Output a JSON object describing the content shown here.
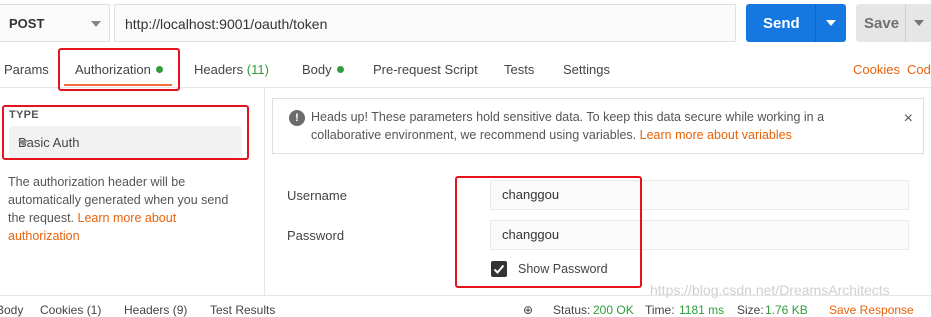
{
  "request": {
    "method": "POST",
    "url": "http://localhost:9001/oauth/token",
    "send_label": "Send",
    "save_label": "Save"
  },
  "tabs": [
    {
      "label": "Params"
    },
    {
      "label": "Authorization",
      "active": true,
      "dot": true
    },
    {
      "label": "Headers",
      "count": "(11)"
    },
    {
      "label": "Body",
      "dot": true
    },
    {
      "label": "Pre-request Script"
    },
    {
      "label": "Tests"
    },
    {
      "label": "Settings"
    }
  ],
  "tab_links": {
    "cookies": "Cookies",
    "code": "Code"
  },
  "auth": {
    "type_label": "TYPE",
    "type_value": "Basic Auth",
    "help_text": "The authorization header will be automatically generated when you send the request.",
    "help_link": "Learn more about authorization"
  },
  "notice": {
    "text": "Heads up! These parameters hold sensitive data. To keep this data secure while working in a collaborative environment, we recommend using variables.",
    "link": "Learn more about variables",
    "close": "×"
  },
  "fields": {
    "username_label": "Username",
    "username_value": "changgou",
    "password_label": "Password",
    "password_value": "changgou",
    "show_password_label": "Show Password",
    "show_password_checked": true
  },
  "response_tabs": [
    "Body",
    "Cookies (1)",
    "Headers (9)",
    "Test Results"
  ],
  "response_status": {
    "status_label": "Status:",
    "status_value": "200 OK",
    "time_label": "Time:",
    "time_value": "1181 ms",
    "size_label": "Size:",
    "size_value": "1.76 KB",
    "save_response": "Save Response"
  },
  "watermark": "https://blog.csdn.net/DreamsArchitects",
  "colors": {
    "accent": "#f26b3a",
    "send": "#1478e0",
    "green": "#2e9d3a",
    "annotation": "#e3141e"
  }
}
